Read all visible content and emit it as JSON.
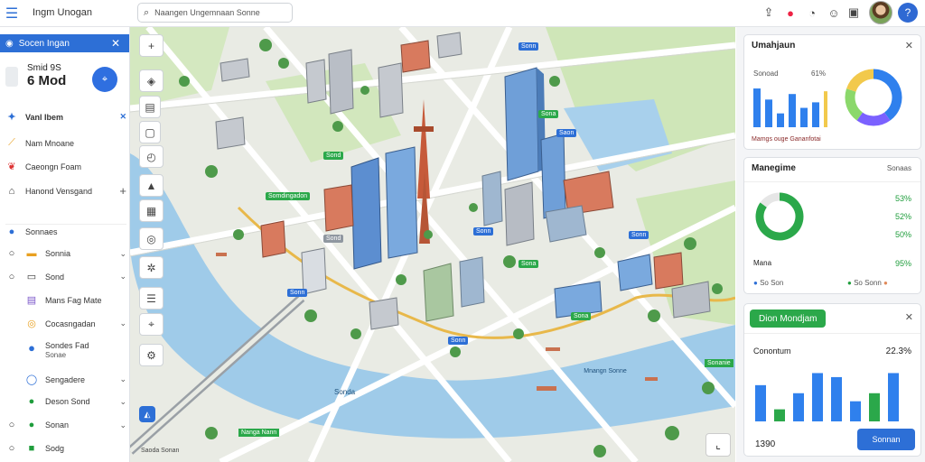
{
  "app": {
    "title": "Ingm Unogan"
  },
  "search": {
    "value": "Naangen Ungemnaan Sonne"
  },
  "sidebar": {
    "header": "Socen Ingan",
    "stat_label": "Smid 9S",
    "stat_value": "6 Mod",
    "items": [
      {
        "label": "Vanl Ibem",
        "icon": "people-icon"
      },
      {
        "label": "Nam Mnoane",
        "icon": "chart-icon"
      },
      {
        "label": "Caeongn Foam",
        "icon": "map-pin-icon"
      },
      {
        "label": "Hanond Vensgand",
        "icon": "home-icon"
      },
      {
        "label": "Sonnaes",
        "icon": "dot-icon"
      },
      {
        "label": "Sonnia",
        "icon": "layer-icon"
      },
      {
        "label": "Sond",
        "icon": "layer-icon"
      },
      {
        "label": "Mans Fag Mate",
        "icon": "flag-icon"
      },
      {
        "label": "Cocasngadan",
        "icon": "globe-icon"
      },
      {
        "label": "Sondes Fad",
        "sub": "Sonae",
        "icon": "pin-icon"
      },
      {
        "label": "Sengadere",
        "icon": "ring-icon"
      },
      {
        "label": "Deson Sond",
        "icon": "dot-icon"
      },
      {
        "label": "Sonan",
        "icon": "dot-icon"
      },
      {
        "label": "Sodg",
        "icon": "square-icon"
      }
    ]
  },
  "map": {
    "labels": [
      "Sonda",
      "Mnangn Sonne",
      "Nanga Nann"
    ],
    "tags": [
      "Sonn",
      "Sona",
      "Saon",
      "Somdingadon",
      "Sond",
      "Sond",
      "Sonn",
      "Sonn",
      "Sona",
      "Sonn",
      "Sonn",
      "Sona"
    ],
    "scale": "Saoda Sonan",
    "green_tag": "Sonanie"
  },
  "cards": {
    "c1": {
      "title": "Umahjaun",
      "sub_label": "Sonoad",
      "sub_pct": "61%",
      "footer": "Mamgs ouge Gananfotai"
    },
    "c2": {
      "title": "Manegime",
      "right": "Sonaas",
      "pct_rows": [
        "53%",
        "52%",
        "50%"
      ],
      "bottom_label": "Mana",
      "bottom_pct": "95%",
      "legend": [
        "So Son",
        "So Sonn"
      ]
    },
    "c3": {
      "pill": "Dion Mondjam",
      "label": "Conontum",
      "pct": "22.3%",
      "footer_num": "1390",
      "button": "Sonnan"
    }
  },
  "chart_data": [
    {
      "type": "bar",
      "categories": [
        "a",
        "b",
        "c",
        "d",
        "e",
        "f",
        "g"
      ],
      "values": [
        28,
        20,
        10,
        24,
        14,
        18,
        26
      ],
      "ylim": [
        0,
        30
      ],
      "colors": [
        "#2f80ed",
        "#2f80ed",
        "#2f80ed",
        "#2f80ed",
        "#2f80ed",
        "#2f80ed",
        "#f2c94c"
      ]
    },
    {
      "type": "pie",
      "values": [
        40,
        20,
        20,
        20
      ],
      "colors": [
        "#2f80ed",
        "#7b61ff",
        "#8bd86b",
        "#f2c94c"
      ]
    },
    {
      "type": "pie",
      "values": [
        85,
        15
      ],
      "colors": [
        "#2ba84a",
        "#e6e6e6"
      ]
    },
    {
      "type": "bar",
      "categories": [
        "a",
        "b",
        "c",
        "d",
        "e",
        "f",
        "g",
        "h"
      ],
      "values": [
        18,
        6,
        14,
        24,
        22,
        10,
        14,
        24
      ],
      "ylim": [
        0,
        26
      ],
      "colors": [
        "#2f80ed",
        "#2ba84a",
        "#2f80ed",
        "#2f80ed",
        "#2f80ed",
        "#2f80ed",
        "#2ba84a",
        "#2f80ed"
      ]
    }
  ]
}
